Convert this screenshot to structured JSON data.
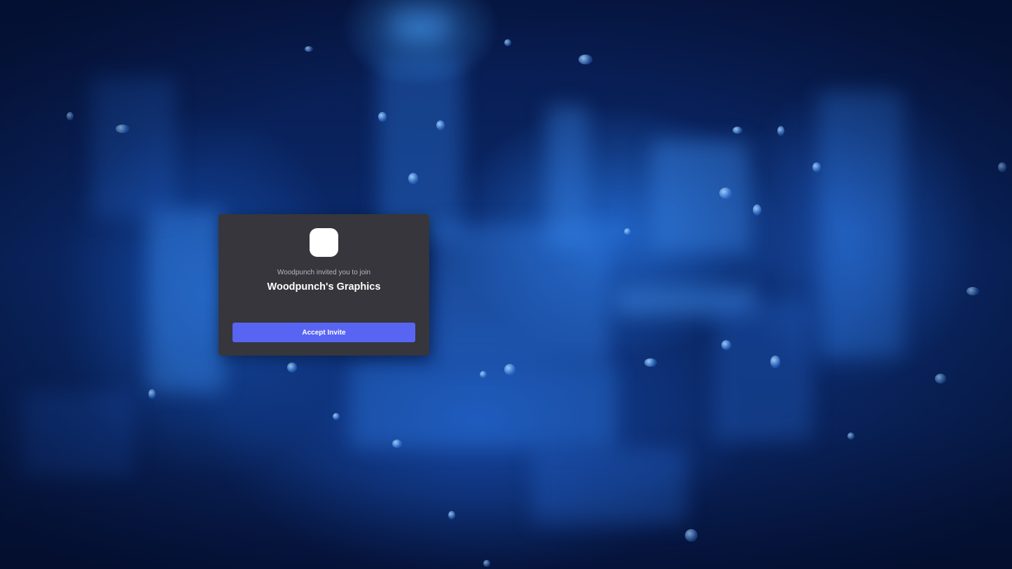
{
  "background": {
    "description_icon": "blurred-city-rain-background"
  },
  "invite": {
    "subtitle": "Woodpunch invited you to join",
    "server_name": "Woodpunch's Graphics",
    "accept_label": "Accept Invite",
    "accent_color": "#5865f2",
    "card_color": "#36363c",
    "server_icon": "server-icon"
  }
}
